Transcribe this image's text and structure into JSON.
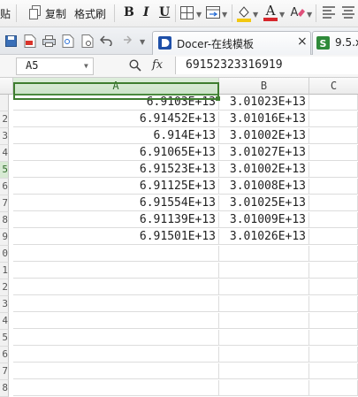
{
  "toolbar1": {
    "paste_label": "贴",
    "copy_label": "复制",
    "format_painter_label": "格式刷",
    "bold": "B",
    "italic": "I",
    "underline": "U"
  },
  "toolbar2": {
    "tabs": [
      {
        "label": "Docer-在线模板",
        "close": "×"
      },
      {
        "label": "9.5.x"
      }
    ]
  },
  "formula_bar": {
    "cell_ref": "A5",
    "fx_label": "fx",
    "formula": "69152323316919"
  },
  "sheet": {
    "columns": [
      "A",
      "B",
      "C"
    ],
    "active_column": "A",
    "active_row": "5",
    "row_labels": [
      "",
      "2",
      "3",
      "4",
      "5",
      "6",
      "7",
      "8",
      "9",
      "0",
      "1",
      "2",
      "3",
      "4",
      "5",
      "6",
      "7",
      "8"
    ],
    "rows": [
      {
        "a": "6.9103E+13",
        "b": "3.01023E+13"
      },
      {
        "a": "6.91452E+13",
        "b": "3.01016E+13"
      },
      {
        "a": "6.914E+13",
        "b": "3.01002E+13"
      },
      {
        "a": "6.91065E+13",
        "b": "3.01027E+13"
      },
      {
        "a": "6.91523E+13",
        "b": "3.01002E+13"
      },
      {
        "a": "6.91125E+13",
        "b": "3.01008E+13"
      },
      {
        "a": "6.91554E+13",
        "b": "3.01025E+13"
      },
      {
        "a": "6.91139E+13",
        "b": "3.01009E+13"
      },
      {
        "a": "6.91501E+13",
        "b": "3.01026E+13"
      }
    ]
  },
  "colors": {
    "accent": "#3e7d2f",
    "font_color": "#d6262b",
    "highlight": "#f2c811"
  }
}
